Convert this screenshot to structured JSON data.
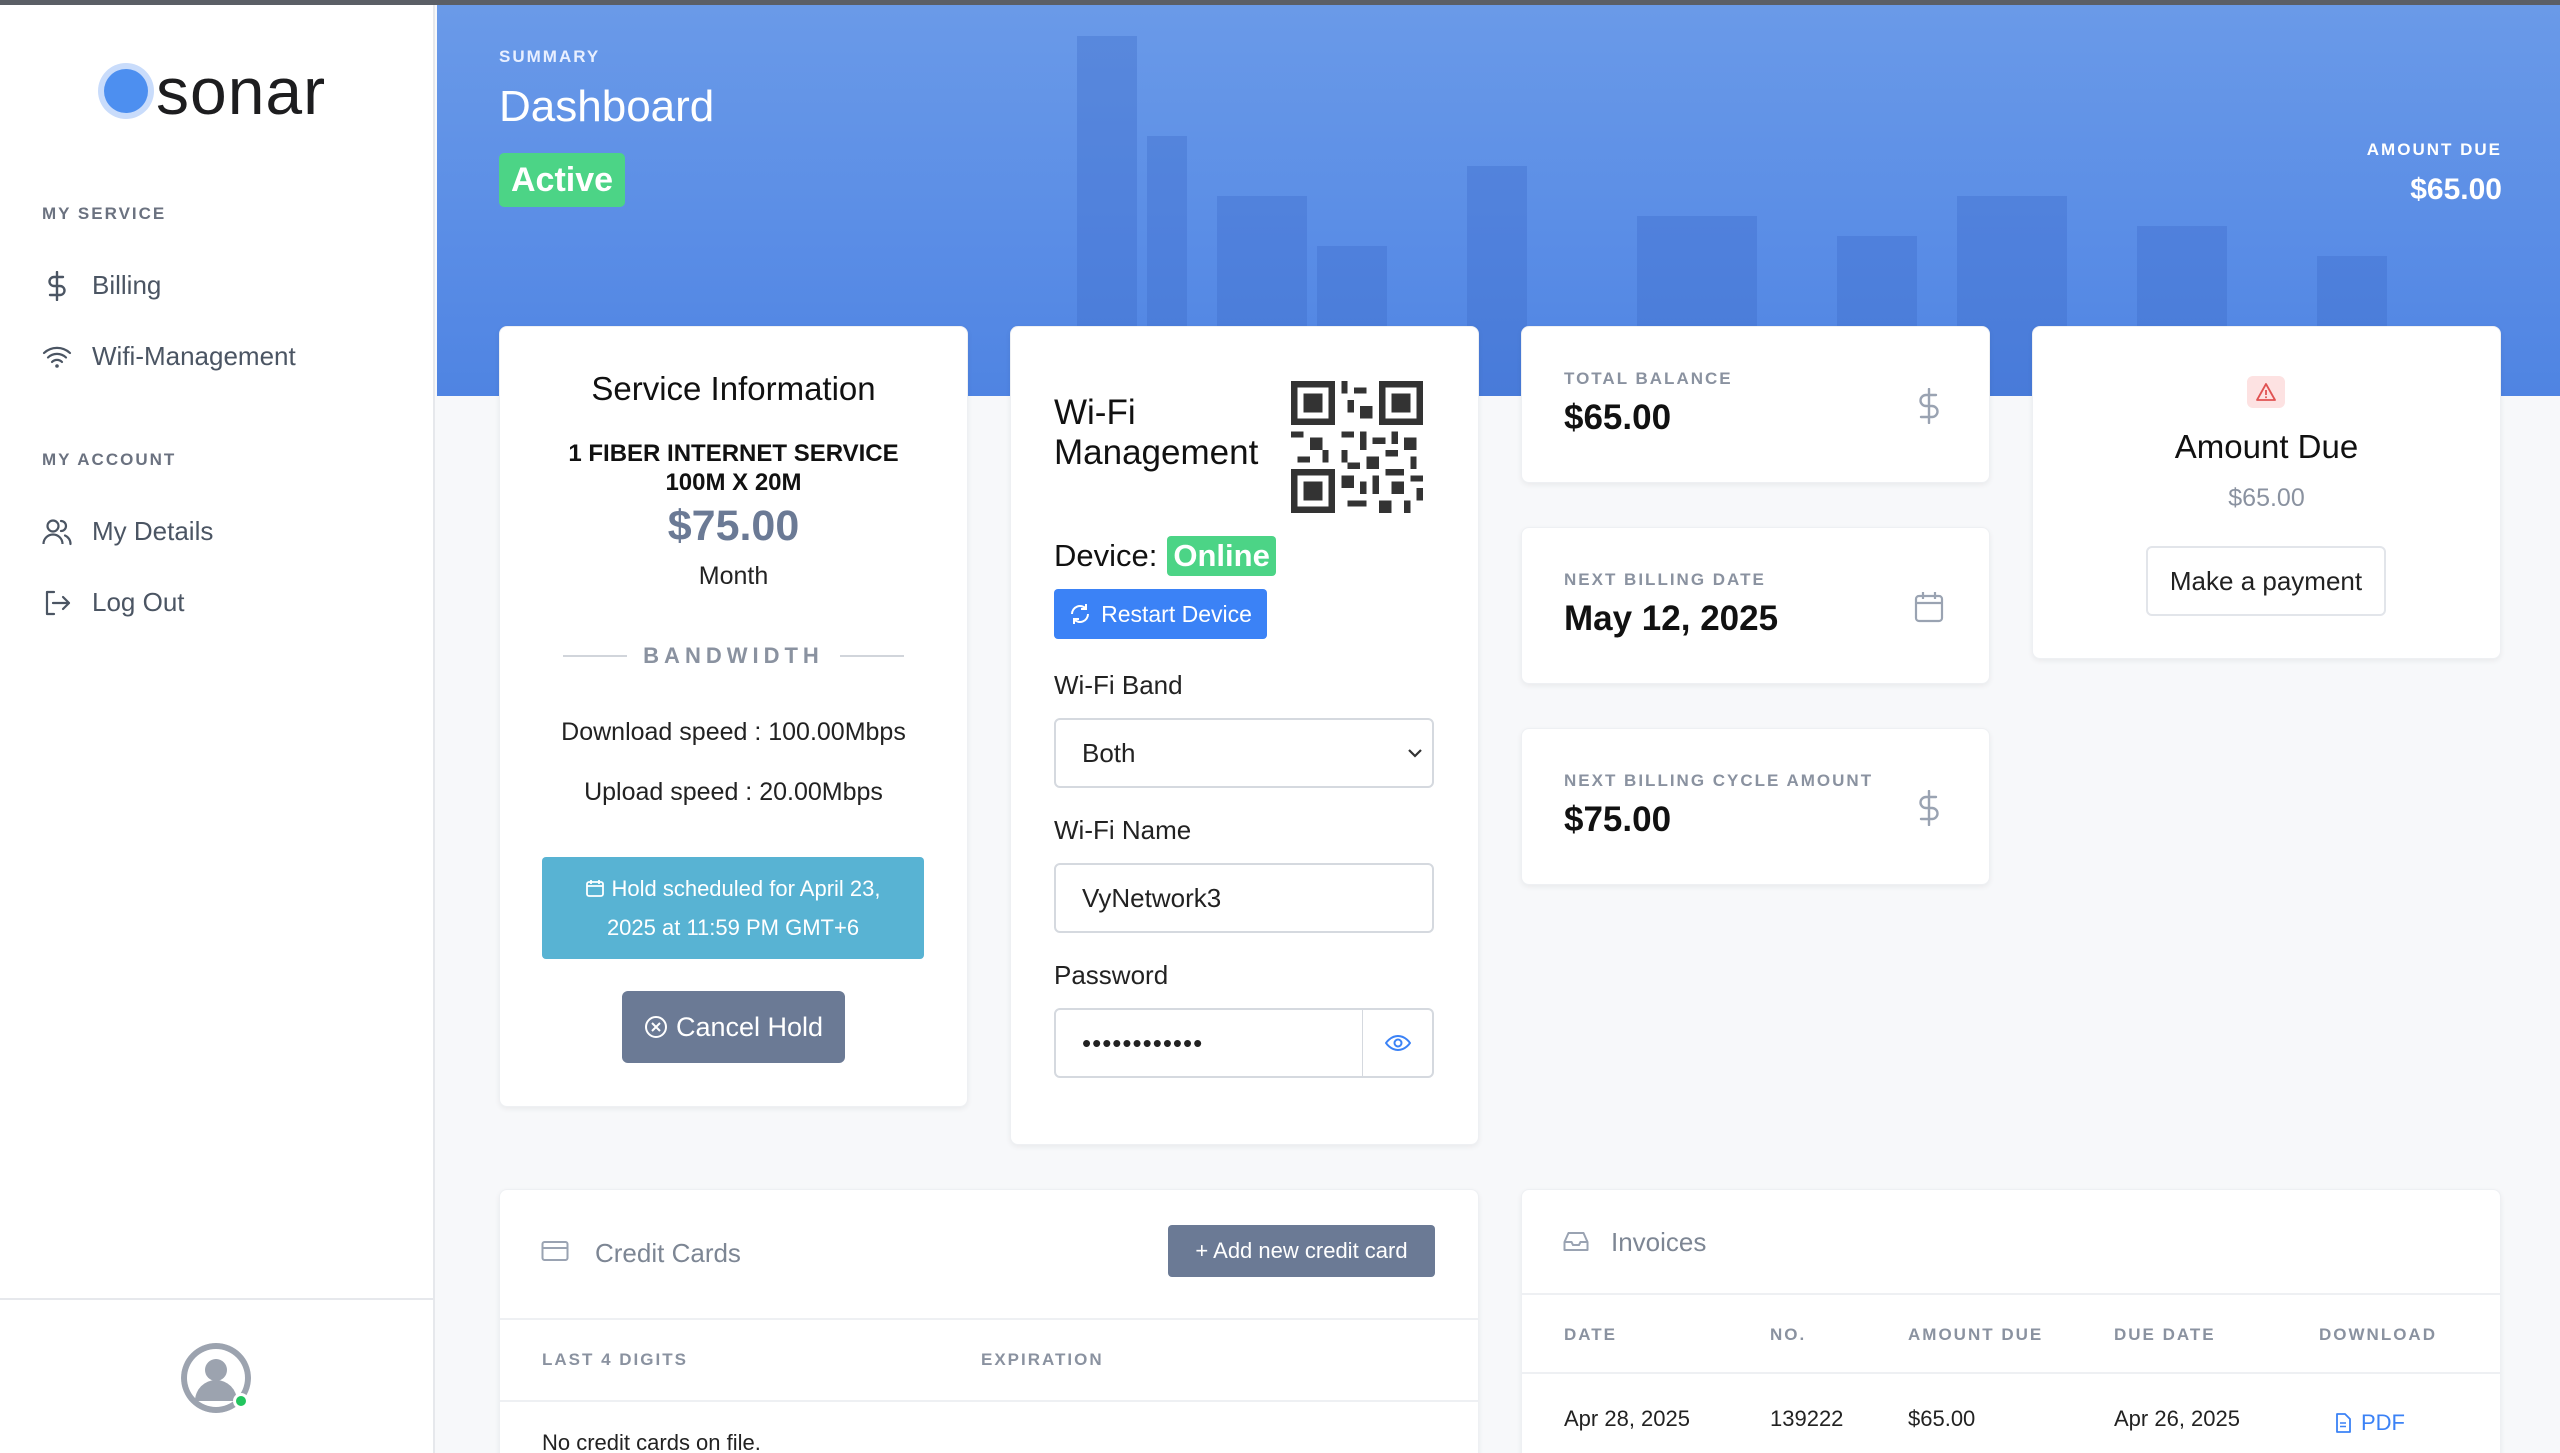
{
  "brand": {
    "name": "sonar",
    "accent": "#4d8ff0"
  },
  "sidebar": {
    "sections": [
      {
        "title": "MY SERVICE",
        "items": [
          {
            "label": "Billing",
            "icon": "dollar-icon"
          },
          {
            "label": "Wifi-Management",
            "icon": "wifi-icon"
          }
        ]
      },
      {
        "title": "MY ACCOUNT",
        "items": [
          {
            "label": "My Details",
            "icon": "users-icon"
          },
          {
            "label": "Log Out",
            "icon": "logout-icon"
          }
        ]
      }
    ]
  },
  "header": {
    "eyebrow": "SUMMARY",
    "title": "Dashboard",
    "status": "Active",
    "amount_due_label": "AMOUNT DUE",
    "amount_due_value": "$65.00"
  },
  "service": {
    "title": "Service Information",
    "plan_line1": "1 FIBER INTERNET SERVICE",
    "plan_line2": "100M X 20M",
    "price": "$75.00",
    "period": "Month",
    "bandwidth_label": "BANDWIDTH",
    "download": "Download speed : 100.00Mbps",
    "upload": "Upload speed : 20.00Mbps",
    "hold_line1": "Hold scheduled for April 23,",
    "hold_line2": "2025 at 11:59 PM GMT+6",
    "cancel_hold": "Cancel Hold"
  },
  "wifi": {
    "title_line1": "Wi-Fi",
    "title_line2": "Management",
    "device_label": "Device:",
    "device_status": "Online",
    "restart_label": "Restart Device",
    "band_label": "Wi-Fi Band",
    "band_value": "Both",
    "name_label": "Wi-Fi Name",
    "name_value": "VyNetwork3",
    "password_label": "Password",
    "password_value": "••••••••••••"
  },
  "stats": {
    "total_balance_label": "TOTAL BALANCE",
    "total_balance_value": "$65.00",
    "next_billing_date_label": "NEXT BILLING DATE",
    "next_billing_date_value": "May 12, 2025",
    "next_cycle_label": "NEXT BILLING CYCLE AMOUNT",
    "next_cycle_value": "$75.00"
  },
  "amount_due_card": {
    "title": "Amount Due",
    "value": "$65.00",
    "button": "Make a payment"
  },
  "credit_cards": {
    "title": "Credit Cards",
    "add_button": "+ Add new credit card",
    "col_last4": "LAST 4 DIGITS",
    "col_expiration": "EXPIRATION",
    "empty": "No credit cards on file."
  },
  "invoices": {
    "title": "Invoices",
    "columns": [
      "DATE",
      "NO.",
      "AMOUNT DUE",
      "DUE DATE",
      "DOWNLOAD"
    ],
    "rows": [
      {
        "date": "Apr 28, 2025",
        "no": "139222",
        "amount": "$65.00",
        "due": "Apr 26, 2025",
        "download": "PDF"
      }
    ]
  }
}
